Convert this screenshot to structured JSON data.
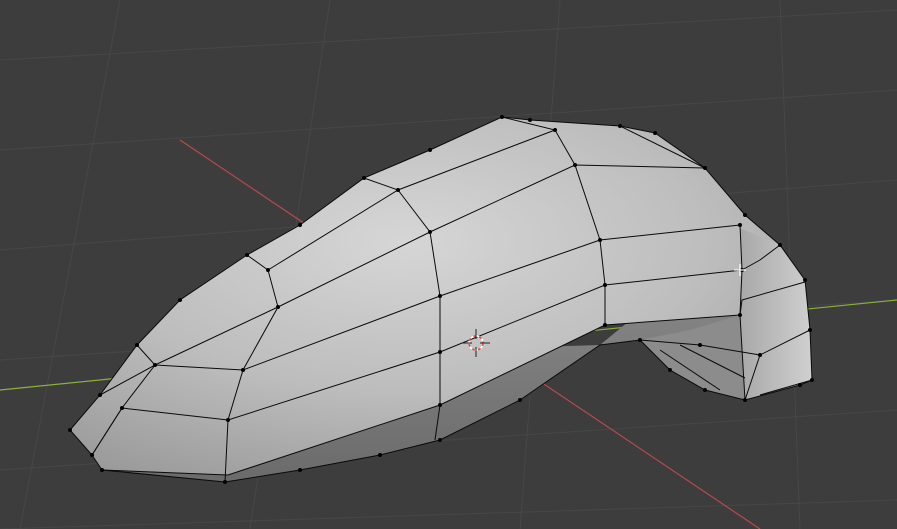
{
  "viewport": {
    "mode": "edit-mode",
    "object_type": "mesh",
    "background_color": "#3d3d3d",
    "grid_color": "#4a4a4a",
    "x_axis_color": "#b84a4a",
    "y_axis_color": "#8ab33a",
    "mesh_face_color": "#b8b8b8",
    "mesh_edge_color": "#0a0a0a",
    "mesh_vertex_color": "#000000",
    "icons": [
      "3d-cursor-icon",
      "mouse-crosshair-icon"
    ]
  }
}
